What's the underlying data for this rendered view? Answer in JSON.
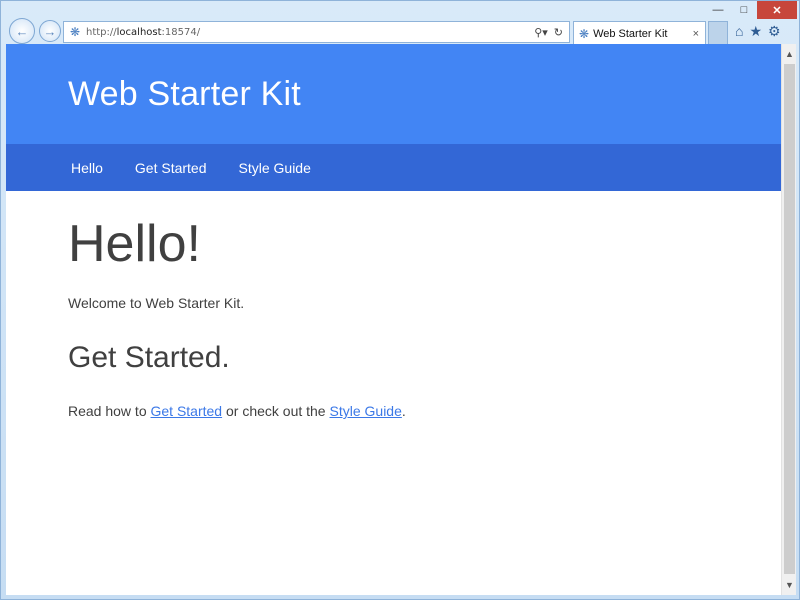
{
  "browser": {
    "address_url_prefix": "http://",
    "address_url_host": "localhost",
    "address_url_rest": ":18574/",
    "tab_title": "Web Starter Kit",
    "tab_close": "×",
    "icons": {
      "back": "back-arrow-icon",
      "forward": "forward-arrow-icon",
      "search": "search-icon",
      "refresh": "refresh-icon",
      "home": "home-icon",
      "favorites": "star-icon",
      "settings": "gear-icon"
    }
  },
  "site": {
    "title": "Web Starter Kit",
    "nav": [
      "Hello",
      "Get Started",
      "Style Guide"
    ]
  },
  "content": {
    "heading": "Hello!",
    "welcome": "Welcome to Web Starter Kit.",
    "subheading": "Get Started.",
    "read_prefix": "Read how to ",
    "link_get_started": "Get Started",
    "read_middle": " or check out the ",
    "link_style_guide": "Style Guide",
    "read_suffix": "."
  },
  "colors": {
    "header": "#4285f4",
    "navbar": "#3367d6",
    "link": "#3b78e7"
  }
}
